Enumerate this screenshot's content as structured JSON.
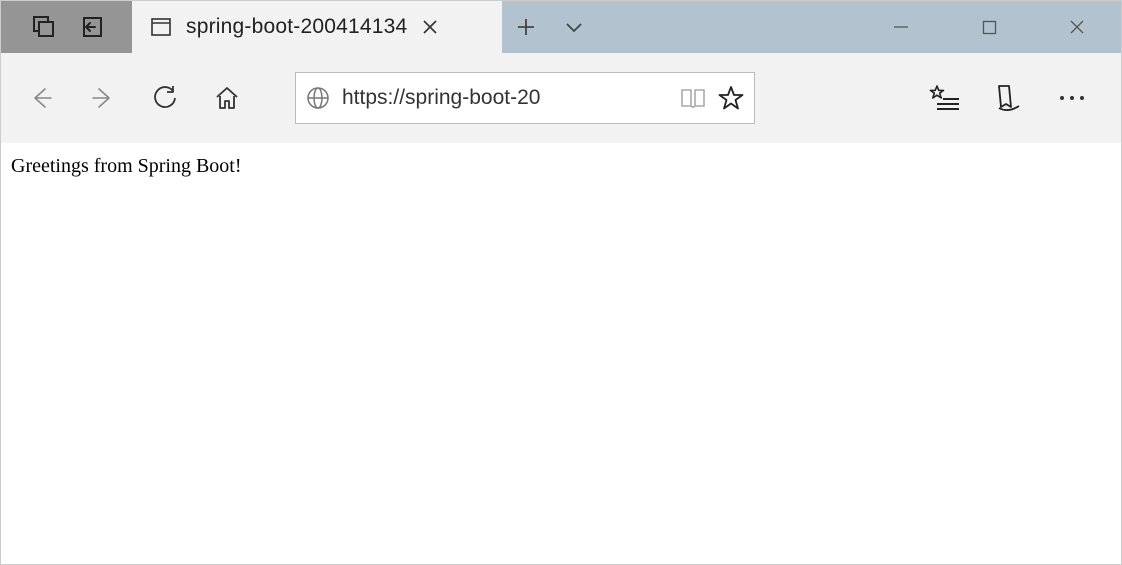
{
  "tab": {
    "title": "spring-boot-200414134"
  },
  "address": {
    "url": "https://spring-boot-20"
  },
  "page": {
    "body_text": "Greetings from Spring Boot!"
  }
}
